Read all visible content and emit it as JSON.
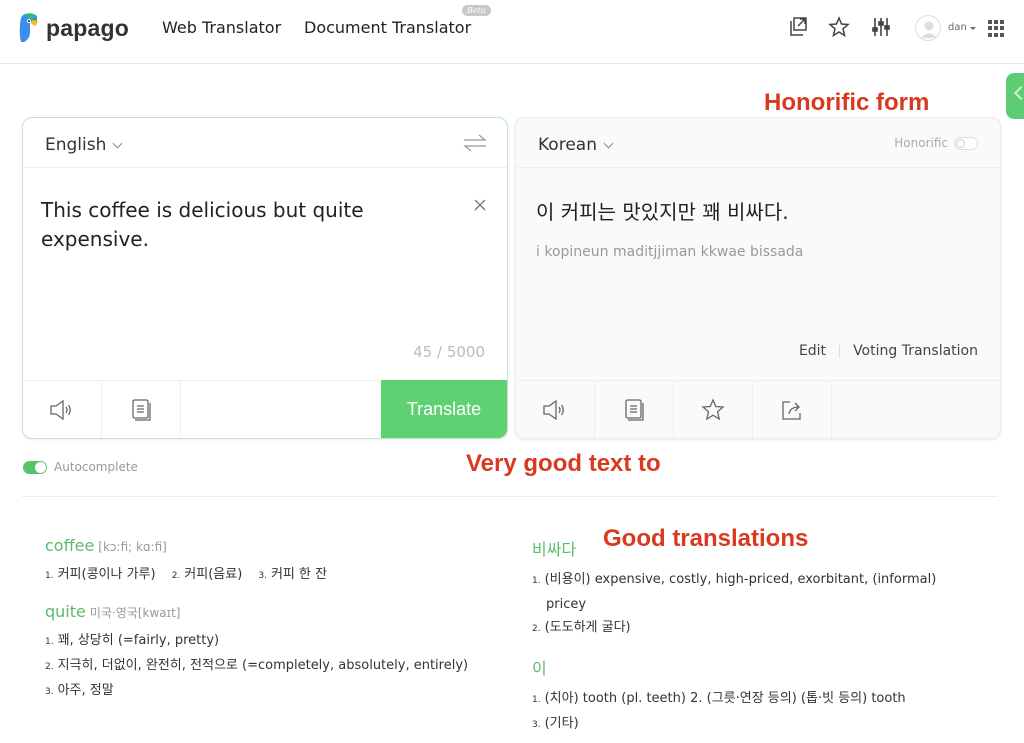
{
  "header": {
    "logo_text": "papago",
    "nav": [
      {
        "label": "Web Translator"
      },
      {
        "label": "Document Translator",
        "badge": "Beta"
      }
    ],
    "icons": [
      "share-window-icon",
      "star-icon",
      "settings-sliders-icon"
    ],
    "user_name": "dan",
    "apps_icon": "grid-icon"
  },
  "annotations": {
    "honorific": "Honorific form",
    "very_good": "Very good text to",
    "good_translations": "Good translations"
  },
  "source": {
    "language": "English",
    "text": "This coffee is delicious but quite expensive.",
    "char_count": "45 / 5000",
    "translate_label": "Translate"
  },
  "target": {
    "language": "Korean",
    "honorific_label": "Honorific",
    "honorific_on": false,
    "text": "이 커피는 맛있지만 꽤 비싸다.",
    "romanization": "i kopineun maditjjiman kkwae bissada",
    "edit_label": "Edit",
    "voting_label": "Voting Translation"
  },
  "autocomplete": {
    "label": "Autocomplete",
    "on": true
  },
  "dictionary": {
    "left": [
      {
        "word": "coffee",
        "pron": "[kɔ:fi; kɑ:fi]",
        "layout": "inline",
        "defs": [
          "커피(콩이나 가루)",
          "커피(음료)",
          "커피 한 잔"
        ]
      },
      {
        "word": "quite",
        "pron": "미국·영국[kwaɪt]",
        "layout": "block",
        "defs": [
          "꽤, 상당히 (=fairly, pretty)",
          "지극히, 더없이, 완전히, 전적으로 (=completely, absolutely, entirely)",
          "아주, 정말"
        ]
      }
    ],
    "right": [
      {
        "word": "비싸다",
        "pron": "",
        "layout": "block",
        "defs": [
          "(비용이) expensive, costly, high-priced, exorbitant, (informal) pricey",
          "(도도하게 굴다)"
        ]
      },
      {
        "word": "이",
        "pron": "",
        "layout": "block",
        "defs": [
          "(치아) tooth (pl. teeth)    2. (그릇·연장 등의) (톱·빗 등의) tooth",
          "(기타)"
        ]
      }
    ]
  },
  "colors": {
    "accent": "#5fd172",
    "annotation": "#d9391f",
    "headword": "#5dba6a"
  }
}
